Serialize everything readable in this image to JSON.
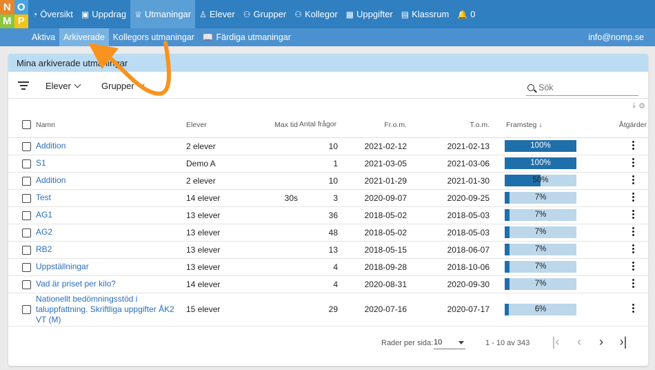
{
  "logo": {
    "letters": [
      "N",
      "O",
      "M",
      "P"
    ]
  },
  "nav": {
    "items": [
      {
        "label": "Översikt",
        "icon": "dashboard-icon",
        "glyph": "◔"
      },
      {
        "label": "Uppdrag",
        "icon": "book-icon",
        "glyph": "▣"
      },
      {
        "label": "Utmaningar",
        "icon": "trophy-icon",
        "glyph": "♕",
        "active": true
      },
      {
        "label": "Elever",
        "icon": "user-icon",
        "glyph": "♙"
      },
      {
        "label": "Grupper",
        "icon": "users-icon",
        "glyph": "⚇"
      },
      {
        "label": "Kollegor",
        "icon": "colleagues-icon",
        "glyph": "⚇"
      },
      {
        "label": "Uppgifter",
        "icon": "grid-icon",
        "glyph": "▦"
      },
      {
        "label": "Klassrum",
        "icon": "classroom-icon",
        "glyph": "▤"
      },
      {
        "label": "0",
        "icon": "bell-icon",
        "glyph": "🔔"
      }
    ]
  },
  "subnav": {
    "items": [
      {
        "label": "Aktiva"
      },
      {
        "label": "Arkiverade",
        "active": true
      },
      {
        "label": "Kollegors utmaningar"
      },
      {
        "label": "Färdiga utmaningar",
        "glyph": "📖"
      }
    ],
    "email": "info@nomp.se"
  },
  "panel": {
    "title": "Mina arkiverade utmaningar"
  },
  "filters": {
    "students": "Elever",
    "groups": "Grupper",
    "search_placeholder": "Sök"
  },
  "table": {
    "headers": {
      "name": "Namn",
      "students": "Elever",
      "max_time": "Max tid",
      "questions": "Antal frågor",
      "from": "Fr.o.m.",
      "to": "T.o.m.",
      "progress": "Framsteg ↓",
      "actions": "Åtgärder"
    },
    "rows": [
      {
        "name": "Addition",
        "students": "2 elever",
        "max_time": "",
        "questions": "10",
        "from": "2021-02-12",
        "to": "2021-02-13",
        "progress": 100,
        "progress_label": "100%"
      },
      {
        "name": "S1",
        "students": "Demo A",
        "max_time": "",
        "questions": "1",
        "from": "2021-03-05",
        "to": "2021-03-06",
        "progress": 100,
        "progress_label": "100%"
      },
      {
        "name": "Addition",
        "students": "2 elever",
        "max_time": "",
        "questions": "10",
        "from": "2021-01-29",
        "to": "2021-01-30",
        "progress": 50,
        "progress_label": "50%"
      },
      {
        "name": "Test",
        "students": "14 elever",
        "max_time": "30s",
        "questions": "3",
        "from": "2020-09-07",
        "to": "2020-09-25",
        "progress": 7,
        "progress_label": "7%"
      },
      {
        "name": "AG1",
        "students": "13 elever",
        "max_time": "",
        "questions": "36",
        "from": "2018-05-02",
        "to": "2018-05-03",
        "progress": 7,
        "progress_label": "7%"
      },
      {
        "name": "AG2",
        "students": "13 elever",
        "max_time": "",
        "questions": "48",
        "from": "2018-05-02",
        "to": "2018-05-03",
        "progress": 7,
        "progress_label": "7%"
      },
      {
        "name": "RB2",
        "students": "13 elever",
        "max_time": "",
        "questions": "13",
        "from": "2018-05-15",
        "to": "2018-06-07",
        "progress": 7,
        "progress_label": "7%"
      },
      {
        "name": "Uppställningar",
        "students": "13 elever",
        "max_time": "",
        "questions": "4",
        "from": "2018-09-28",
        "to": "2018-10-06",
        "progress": 7,
        "progress_label": "7%"
      },
      {
        "name": "Vad är priset per kilo?",
        "students": "14 elever",
        "max_time": "",
        "questions": "4",
        "from": "2020-08-31",
        "to": "2020-09-30",
        "progress": 7,
        "progress_label": "7%"
      },
      {
        "name": "Nationellt bedömningsstöd i taluppfattning. Skriftliga uppgifter ÅK2 VT (M)",
        "students": "15 elever",
        "max_time": "",
        "questions": "29",
        "from": "2020-07-16",
        "to": "2020-07-17",
        "progress": 6,
        "progress_label": "6%"
      }
    ]
  },
  "pagination": {
    "rows_per_page_label": "Rader per sida:",
    "rows_per_page": "10",
    "range": "1 - 10 av 343"
  },
  "colors": {
    "nav": "#2f7fc1",
    "subnav": "#4c91cf",
    "progress_fill": "#1f6fab",
    "progress_track": "#bcd7ea",
    "arrow": "#f7931e"
  }
}
